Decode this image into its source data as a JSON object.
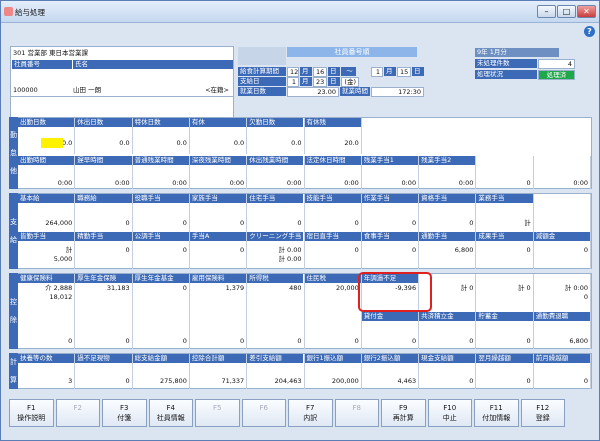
{
  "window": {
    "title": "給与処理",
    "min": "▭",
    "max": "▭",
    "close": "✕"
  },
  "help": "?",
  "employee": {
    "dept": "301 営業部 東日本営業課",
    "num_label": "社員番号",
    "name_label": "氏名",
    "num": "100000",
    "name": "山田 一朗",
    "status": "<在籍>"
  },
  "period": {
    "header": "社員番号順",
    "calc_label": "給食計算期間",
    "from_m": "12",
    "m1": "月",
    "from_d": "16",
    "d1": "日",
    "tilde": "～",
    "to_m": "1",
    "m2": "月",
    "to_d": "15",
    "d2": "日",
    "pay_label": "支給日",
    "pay_m": "1",
    "pay_mu": "月",
    "pay_d": "23",
    "pay_du": "日",
    "pay_w": "(金)",
    "work_label": "就業日数",
    "work_days": "23.00",
    "work_time_label": "就業時間",
    "work_time": "172:30"
  },
  "status": {
    "year": "9年 1月分",
    "done_label": "未処理件数",
    "done_count": "4",
    "proc_label": "処理状況",
    "proc_value": "処理済"
  },
  "kintai": {
    "side": [
      "勤",
      "怠",
      "他"
    ],
    "row1_headers": [
      "出勤日数",
      "休出日数",
      "特休日数",
      "有休",
      "欠勤日数",
      "有休残"
    ],
    "row1_values": [
      "0.0",
      "0.0",
      "0.0",
      "0.0",
      "0.0",
      "20.0"
    ],
    "row2_headers": [
      "出勤時間",
      "遅早時間",
      "普通残業時間",
      "深夜残業時間",
      "休出残業時間",
      "法定休日時間",
      "残業手当1",
      "残業手当2",
      "",
      ""
    ],
    "row2_values": [
      "0:00",
      "0:00",
      "0:00",
      "0:00",
      "0:00",
      "0:00",
      "0:00",
      "0:00",
      "0",
      "0:00"
    ]
  },
  "shikyu": {
    "side": [
      "支",
      "給"
    ],
    "row1_headers": [
      "基本給",
      "職務給",
      "役職手当",
      "家族手当",
      "住宅手当",
      "技能手当",
      "作業手当",
      "資格手当",
      "業務手当",
      ""
    ],
    "row1_values": [
      "264,000",
      "0",
      "0",
      "0",
      "0",
      "0",
      "0",
      "0",
      "計",
      ""
    ],
    "row2_headers": [
      "皆勤手当",
      "精勤手当",
      "公調手当",
      "手当A",
      "クリーニング手当",
      "宿日直手当",
      "食事手当",
      "通勤手当",
      "成果手当",
      "減額金"
    ],
    "row2_values": [
      "計\n5,000",
      "0",
      "0",
      "0",
      "計 0.00\n計 0.00",
      "0",
      "0",
      "6,800",
      "0",
      "0"
    ]
  },
  "kojo": {
    "side": [
      "控",
      "除"
    ],
    "row1_headers": [
      "健康保険料",
      "厚生年金保険",
      "厚生年金基金",
      "雇用保険料",
      "所得税",
      "住民税",
      "年調過不足",
      "",
      "",
      ""
    ],
    "row1_values": [
      "介 2,888\n18,012",
      "31,183",
      "0",
      "1,379",
      "480",
      "20,000",
      "-9,396",
      "計 0",
      "計 0",
      "計 0:00\n0"
    ],
    "row2_headers": [
      "",
      "",
      "",
      "",
      "",
      "",
      "貸付金",
      "共済積立金",
      "貯蓄金",
      "通勤費退職"
    ],
    "row2_values": [
      "0",
      "0",
      "0",
      "0",
      "0",
      "0",
      "0",
      "0",
      "0",
      "6,800"
    ]
  },
  "kei": {
    "side": [
      "計",
      "算"
    ],
    "headers": [
      "扶養等の数",
      "過不足現物",
      "総支給金額",
      "控除合計額",
      "差引支給額",
      "銀行1振込額",
      "銀行2振込額",
      "現金支給額",
      "翌月繰越額",
      "前月繰越額"
    ],
    "values": [
      "3",
      "0",
      "275,800",
      "71,337",
      "204,463",
      "200,000",
      "4,463",
      "0",
      "0",
      "0"
    ]
  },
  "fkeys": [
    {
      "n": "F1",
      "l": "操作説明",
      "dis": false
    },
    {
      "n": "F2",
      "l": "",
      "dis": true
    },
    {
      "n": "F3",
      "l": "付箋",
      "dis": false
    },
    {
      "n": "F4",
      "l": "社員情報",
      "dis": false
    },
    {
      "n": "F5",
      "l": "",
      "dis": true
    },
    {
      "n": "F6",
      "l": "",
      "dis": true
    },
    {
      "n": "F7",
      "l": "内訳",
      "dis": false
    },
    {
      "n": "F8",
      "l": "",
      "dis": true
    },
    {
      "n": "F9",
      "l": "再計算",
      "dis": false
    },
    {
      "n": "F10",
      "l": "中止",
      "dis": false
    },
    {
      "n": "F11",
      "l": "付加情報",
      "dis": false
    },
    {
      "n": "F12",
      "l": "登録",
      "dis": false
    }
  ]
}
